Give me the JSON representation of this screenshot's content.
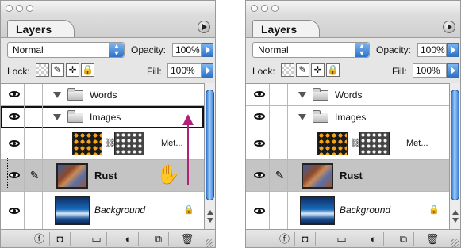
{
  "panels": [
    {
      "tab_label": "Layers",
      "blend_mode": "Normal",
      "opacity_label": "Opacity:",
      "opacity_value": "100%",
      "lock_label": "Lock:",
      "fill_label": "Fill:",
      "fill_value": "100%",
      "layers": [
        {
          "name": "Words",
          "type": "group"
        },
        {
          "name": "Images",
          "type": "group"
        },
        {
          "name": "Met...",
          "type": "layer-with-mask"
        },
        {
          "name": "Rust",
          "type": "layer",
          "selected": true
        },
        {
          "name": "Background",
          "type": "background",
          "locked": true
        }
      ]
    },
    {
      "tab_label": "Layers",
      "blend_mode": "Normal",
      "opacity_label": "Opacity:",
      "opacity_value": "100%",
      "lock_label": "Lock:",
      "fill_label": "Fill:",
      "fill_value": "100%",
      "layers": [
        {
          "name": "Words",
          "type": "group"
        },
        {
          "name": "Images",
          "type": "group"
        },
        {
          "name": "Met...",
          "type": "layer-with-mask"
        },
        {
          "name": "Rust",
          "type": "layer",
          "selected": true
        },
        {
          "name": "Background",
          "type": "background",
          "locked": true
        }
      ]
    }
  ],
  "colors": {
    "drag_arrow": "#b0227a",
    "selected_row": "#c4c4c4",
    "scrollbar_thumb": "#3a7dd5"
  },
  "icons": [
    "eye-icon",
    "folder-icon",
    "disclosure-triangle-icon",
    "chain-link-icon",
    "brush-icon",
    "lock-icon",
    "grab-hand-icon",
    "layer-style-icon",
    "mask-icon",
    "new-group-icon",
    "adjustment-layer-icon",
    "new-layer-icon",
    "trash-icon"
  ]
}
